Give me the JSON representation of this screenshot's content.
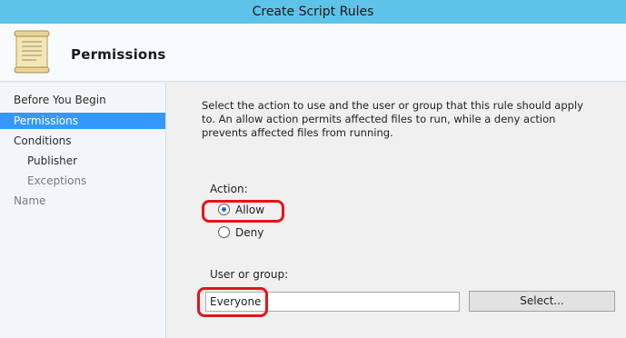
{
  "window": {
    "title": "Create Script Rules"
  },
  "header": {
    "title": "Permissions",
    "icon": "document-icon"
  },
  "nav": {
    "items": [
      {
        "label": "Before You Begin"
      },
      {
        "label": "Permissions"
      },
      {
        "label": "Conditions"
      },
      {
        "label": "Publisher"
      },
      {
        "label": "Exceptions"
      },
      {
        "label": "Name"
      }
    ]
  },
  "content": {
    "description": "Select the action to use and the user or group that this rule should apply to. An allow action permits affected files to run, while a deny action prevents affected files from running.",
    "action_label": "Action:",
    "allow_label": "Allow",
    "deny_label": "Deny",
    "user_group_label": "User or group:",
    "user_group_value": "Everyone",
    "select_button": "Select..."
  },
  "colors": {
    "titlebar": "#5ec3e8",
    "nav_selected": "#3399ff",
    "highlight": "#e0161b"
  }
}
